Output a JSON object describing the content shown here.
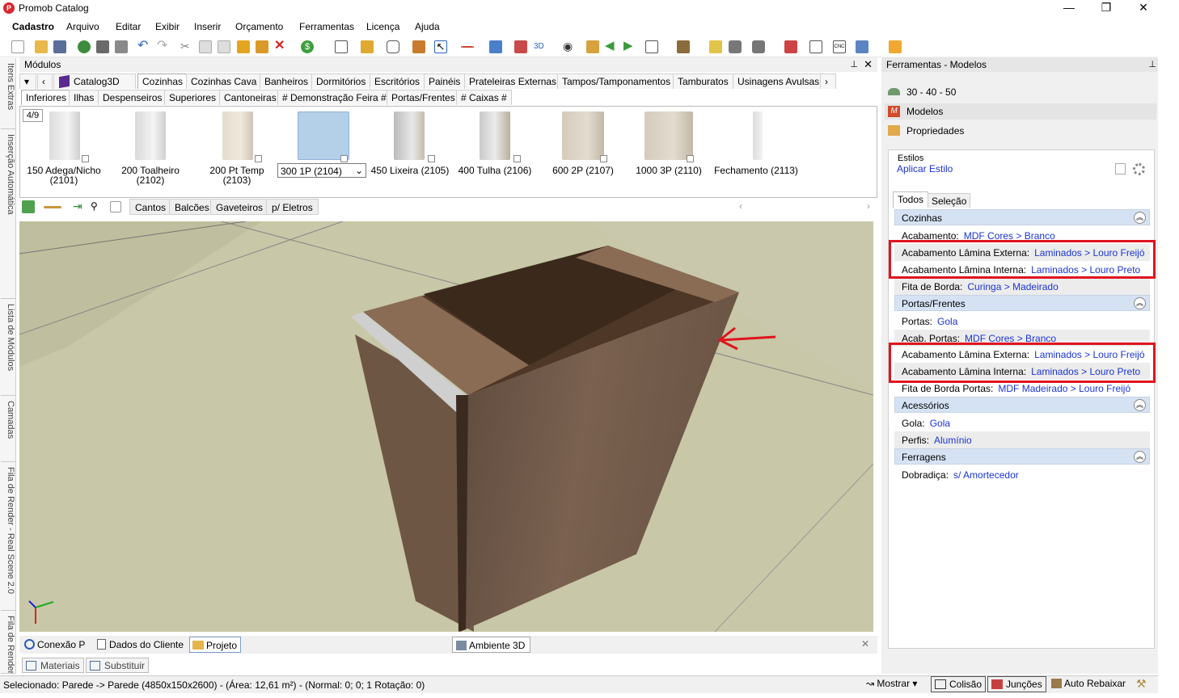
{
  "window": {
    "title": "Promob Catalog",
    "controls": [
      "—",
      "❐",
      "✕"
    ]
  },
  "menu": [
    "Cadastro",
    "Arquivo",
    "Editar",
    "Exibir",
    "Inserir",
    "Orçamento",
    "Ferramentas",
    "Licença",
    "Ajuda"
  ],
  "side_tabs": [
    "Itens Extras",
    "Inserção Automática",
    "Lista de Módulos",
    "Camadas",
    "Fila de Render - Real Scene 2.0",
    "Fila de Render - Real Sce"
  ],
  "modulos": {
    "title": "Módulos",
    "catalog": "Catalog3D",
    "tabs": [
      "Cozinhas",
      "Cozinhas Cava",
      "Banheiros",
      "Dormitórios",
      "Escritórios",
      "Painéis",
      "Prateleiras Externas",
      "Tampos/Tamponamentos",
      "Tamburatos",
      "Usinagens Avulsas"
    ],
    "subtabs": [
      "Inferiores",
      "Ilhas",
      "Despenseiros",
      "Superiores",
      "Cantoneiras",
      "# Demonstração Feira #",
      "Portas/Frentes",
      "# Caixas #"
    ],
    "page": "4/9",
    "items": [
      "150 Adega/Nicho (2101)",
      "200 Toalheiro (2102)",
      "200 Pt Temp (2103)",
      "300 1P (2104)",
      "450 Lixeira (2105)",
      "400 Tulha (2106)",
      "600 2P (2107)",
      "1000 3P (2110)",
      "Fechamento (2113)"
    ],
    "filters": [
      "Cantos",
      "Balcões",
      "Gaveteiros",
      "p/ Eletros"
    ]
  },
  "bottom_tabs": {
    "left": [
      "Conexão P",
      "Dados do Cliente",
      "Projeto"
    ],
    "center": "Ambiente 3D",
    "lower": [
      "Materiais",
      "Substituir"
    ]
  },
  "status": {
    "text": "Selecionado: Parede -> Parede (4850x150x2600) - (Área: 12,61 m²) - (Normal: 0; 0; 1 Rotação: 0)",
    "mostrar": "Mostrar",
    "colisao": "Colisão",
    "juncoes": "Junções",
    "auto": "Auto Rebaixar"
  },
  "tools": {
    "title": "Ferramentas - Modelos",
    "items": [
      "30 - 40 - 50",
      "Modelos",
      "Propriedades"
    ],
    "estilos": "Estilos",
    "aplicar": "Aplicar Estilo",
    "tabs": [
      "Todos",
      "Seleção"
    ],
    "sections": {
      "cozinhas": {
        "title": "Cozinhas",
        "rows": [
          [
            "Acabamento:",
            "MDF Cores > Branco"
          ],
          [
            "Acabamento Lâmina Externa:",
            "Laminados > Louro Freijó"
          ],
          [
            "Acabamento Lâmina Interna:",
            "Laminados > Louro Preto"
          ],
          [
            "Fita de Borda:",
            "Curinga > Madeirado"
          ]
        ]
      },
      "portas": {
        "title": "Portas/Frentes",
        "rows": [
          [
            "Portas:",
            "Gola"
          ],
          [
            "Acab. Portas:",
            "MDF Cores > Branco"
          ],
          [
            "Acabamento Lâmina Externa:",
            "Laminados > Louro Freijó"
          ],
          [
            "Acabamento Lâmina Interna:",
            "Laminados > Louro Preto"
          ],
          [
            "Fita de Borda Portas:",
            "MDF Madeirado > Louro Freijó"
          ]
        ]
      },
      "acessorios": {
        "title": "Acessórios",
        "rows": [
          [
            "Gola:",
            "Gola"
          ],
          [
            "Perfis:",
            "Alumínio"
          ]
        ]
      },
      "ferragens": {
        "title": "Ferragens",
        "rows": [
          [
            "Dobradiça:",
            "s/ Amortecedor"
          ]
        ]
      }
    }
  },
  "colors": {
    "highlight": "#e0141e",
    "link": "#1a34d3",
    "section": "#d5e2f3",
    "floor": "#c7c6a6",
    "wood": "#6e5645"
  }
}
